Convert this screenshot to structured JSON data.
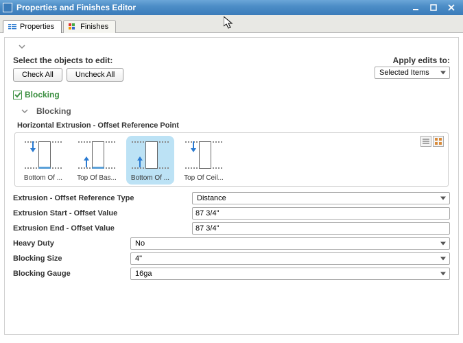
{
  "window": {
    "title": "Properties and Finishes Editor"
  },
  "tabs": {
    "properties": "Properties",
    "finishes": "Finishes",
    "active": "properties"
  },
  "header": {
    "select_label": "Select the objects to edit:",
    "apply_label": "Apply edits to:",
    "apply_value": "Selected Items",
    "check_all": "Check All",
    "uncheck_all": "Uncheck All"
  },
  "blocking_checkbox": {
    "label": "Blocking",
    "checked": true
  },
  "section": {
    "title": "Blocking"
  },
  "offset_ref": {
    "group_label": "Horizontal Extrusion - Offset Reference Point",
    "options": [
      {
        "label": "Bottom Of ..."
      },
      {
        "label": "Top Of Bas..."
      },
      {
        "label": "Bottom Of ..."
      },
      {
        "label": "Top Of Ceil..."
      }
    ],
    "selected_index": 2
  },
  "fields": {
    "ref_type": {
      "label": "Extrusion - Offset Reference Type",
      "value": "Distance"
    },
    "start_value": {
      "label": "Extrusion Start - Offset Value",
      "value": "87 3/4\""
    },
    "end_value": {
      "label": "Extrusion End - Offset Value",
      "value": "87 3/4\""
    },
    "heavy_duty": {
      "label": "Heavy Duty",
      "value": "No"
    },
    "size": {
      "label": "Blocking Size",
      "value": "4\""
    },
    "gauge": {
      "label": "Blocking Gauge",
      "value": "16ga"
    }
  }
}
